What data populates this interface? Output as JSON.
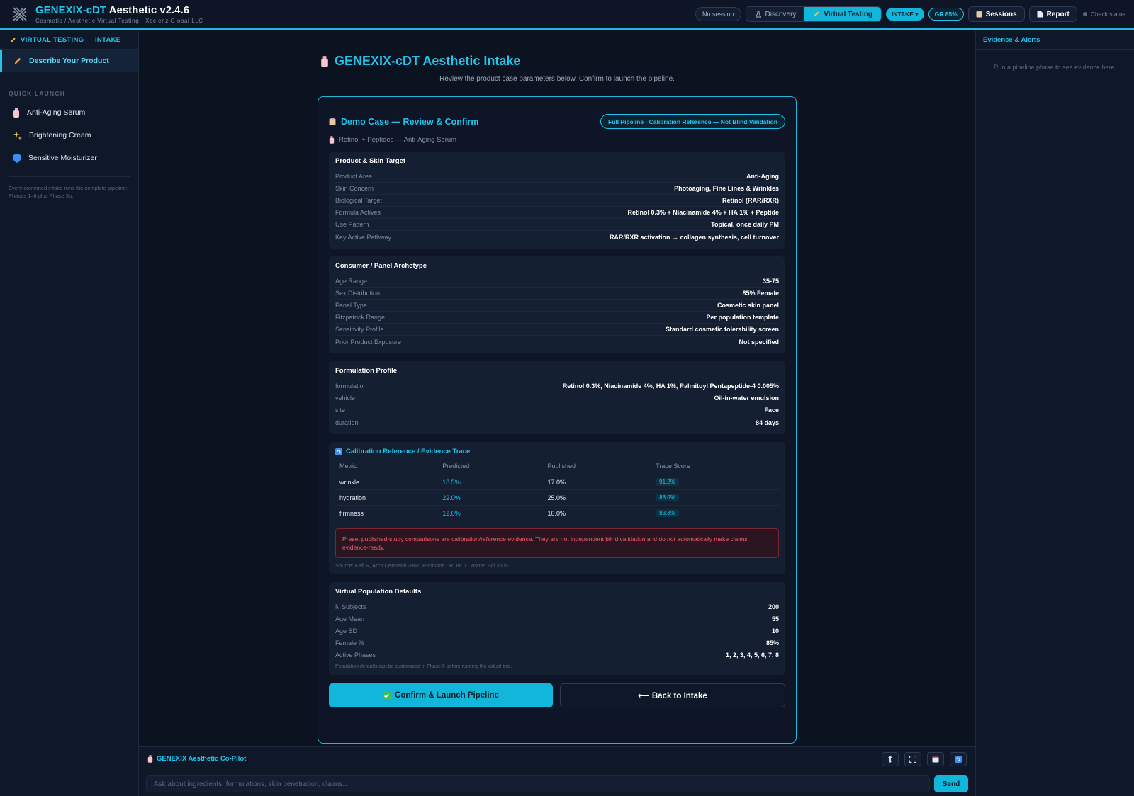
{
  "app": {
    "title_accent": "GENEXIX-cDT",
    "title_rest": " Aesthetic v2.4.6",
    "subtitle": "Cosmetic / Aesthetic Virtual Testing · Xcelenz Global LLC"
  },
  "topbar": {
    "session": "No session",
    "discovery": "Discovery",
    "virtual_testing": "Virtual Testing",
    "intake": "INTAKE ▾",
    "gr": "GR 85%",
    "sessions": "Sessions",
    "report": "Report",
    "status": "Check status"
  },
  "sidebar": {
    "header": "VIRTUAL TESTING — INTAKE",
    "active": "Describe Your Product",
    "quick_launch": "QUICK LAUNCH",
    "items": [
      {
        "label": "Anti-Aging Serum",
        "icon": "bottle-icon"
      },
      {
        "label": "Brightening Cream",
        "icon": "sparkle-icon"
      },
      {
        "label": "Sensitive Moisturizer",
        "icon": "shield-icon"
      }
    ],
    "note": "Every confirmed intake runs the complete pipeline: Phases 1–8 plus Phase 5b."
  },
  "right_panel": {
    "title": "Evidence & Alerts",
    "empty": "Run a pipeline phase to see evidence here."
  },
  "main": {
    "title": "GENEXIX-cDT Aesthetic Intake",
    "subtitle": "Review the product case parameters below. Confirm to launch the pipeline.",
    "card_title": "Demo Case — Review & Confirm",
    "badge": "Full Pipeline · Calibration Reference — Not Blind Validation",
    "case_sub": "Retinol + Peptides — Anti-Aging Serum",
    "product": {
      "title": "Product & Skin Target",
      "rows": [
        {
          "k": "Product Area",
          "v": "Anti-Aging"
        },
        {
          "k": "Skin Concern",
          "v": "Photoaging, Fine Lines & Wrinkles"
        },
        {
          "k": "Biological Target",
          "v": "Retinol (RAR/RXR)"
        },
        {
          "k": "Formula Actives",
          "v": "Retinol 0.3% + Niacinamide 4% + HA 1% + Peptide"
        },
        {
          "k": "Use Pattern",
          "v": "Topical, once daily PM"
        },
        {
          "k": "Key Active Pathway",
          "v": "RAR/RXR activation → collagen synthesis, cell turnover"
        }
      ]
    },
    "consumer": {
      "title": "Consumer / Panel Archetype",
      "rows": [
        {
          "k": "Age Range",
          "v": "35-75"
        },
        {
          "k": "Sex Distribution",
          "v": "85% Female"
        },
        {
          "k": "Panel Type",
          "v": "Cosmetic skin panel"
        },
        {
          "k": "Fitzpatrick Range",
          "v": "Per population template"
        },
        {
          "k": "Sensitivity Profile",
          "v": "Standard cosmetic tolerability screen"
        },
        {
          "k": "Prior Product Exposure",
          "v": "Not specified"
        }
      ]
    },
    "formulation": {
      "title": "Formulation Profile",
      "rows": [
        {
          "k": "formulation",
          "v": "Retinol 0.3%, Niacinamide 4%, HA 1%, Palmitoyl Pentapeptide-4 0.005%"
        },
        {
          "k": "vehicle",
          "v": "Oil-in-water emulsion"
        },
        {
          "k": "site",
          "v": "Face"
        },
        {
          "k": "duration",
          "v": "84 days"
        }
      ]
    },
    "calibration": {
      "title": "Calibration Reference / Evidence Trace",
      "headers": [
        "Metric",
        "Predicted",
        "Published",
        "Trace Score"
      ],
      "rows": [
        {
          "metric": "wrinkle",
          "predicted": "18.5%",
          "published": "17.0%",
          "score": "91.2%"
        },
        {
          "metric": "hydration",
          "predicted": "22.0%",
          "published": "25.0%",
          "score": "88.0%"
        },
        {
          "metric": "firmness",
          "predicted": "12.0%",
          "published": "10.0%",
          "score": "83.3%"
        }
      ],
      "warning": "Preset published-study comparisons are calibration/reference evidence. They are not independent blind validation and do not automatically make claims evidence-ready.",
      "source": "Source: Kafi R, Arch Dermatol 2007; Robinson LR, Int J Cosmet Sci 2005"
    },
    "population": {
      "title": "Virtual Population Defaults",
      "rows": [
        {
          "k": "N Subjects",
          "v": "200"
        },
        {
          "k": "Age Mean",
          "v": "55"
        },
        {
          "k": "Age SD",
          "v": "10"
        },
        {
          "k": "Female %",
          "v": "85%"
        },
        {
          "k": "Active Phases",
          "v": "1, 2, 3, 4, 5, 6, 7, 8"
        }
      ],
      "note": "Population defaults can be customized in Phase 5 before running the virtual trial."
    },
    "confirm": "Confirm & Launch Pipeline",
    "back": "⟵ Back to Intake"
  },
  "copilot": {
    "title": "GENEXIX Aesthetic Co-Pilot",
    "placeholder": "Ask about ingredients, formulations, skin penetration, claims...",
    "send": "Send"
  },
  "colors": {
    "accent": "#22c4ea",
    "background": "#0b1220",
    "panel": "#151f32",
    "warning": "#ff5a6e"
  }
}
